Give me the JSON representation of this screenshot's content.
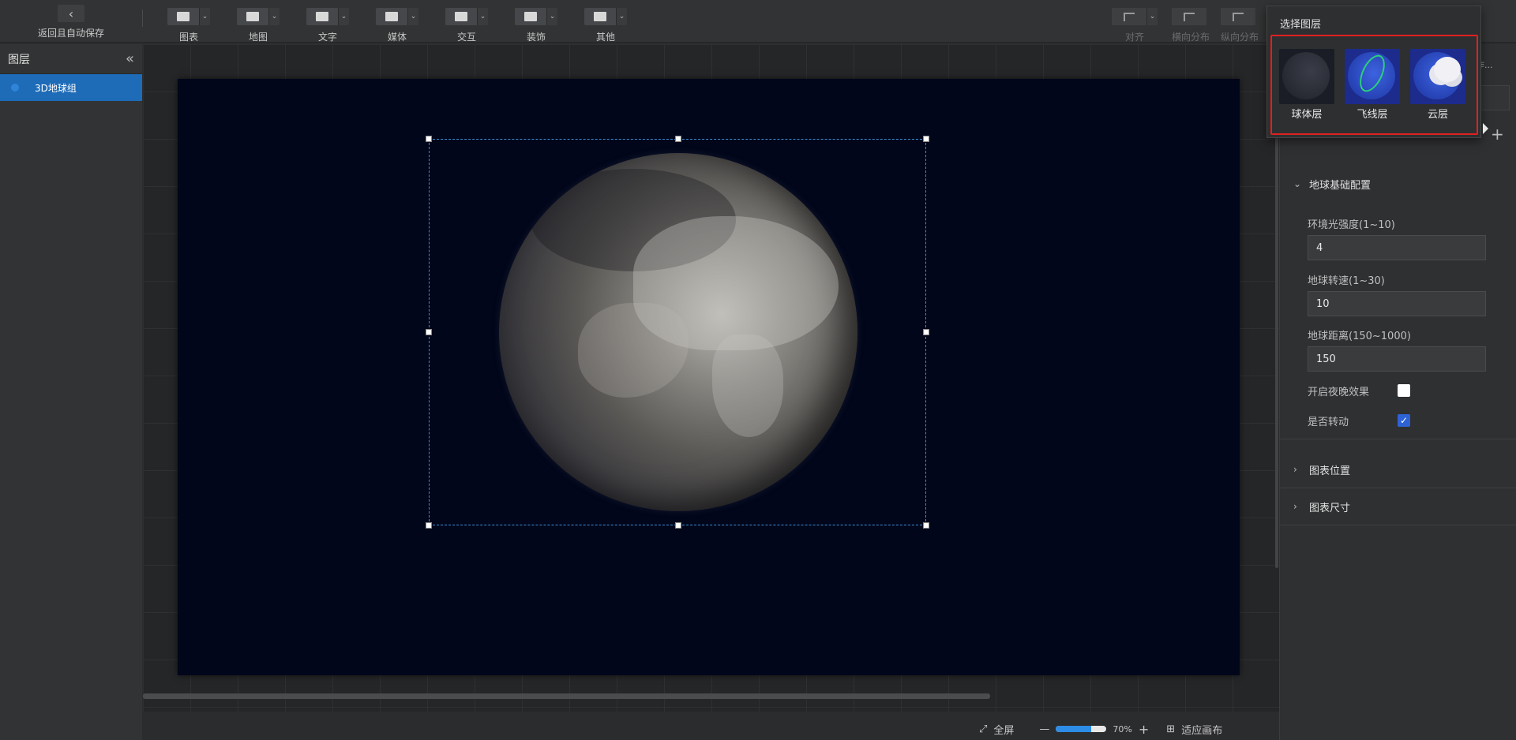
{
  "toolbar": {
    "back_label": "返回且自动保存",
    "items": [
      {
        "label": "图表",
        "icon": "chart-icon"
      },
      {
        "label": "地图",
        "icon": "map-icon"
      },
      {
        "label": "文字",
        "icon": "text-icon"
      },
      {
        "label": "媒体",
        "icon": "media-icon"
      },
      {
        "label": "交互",
        "icon": "interaction-icon"
      },
      {
        "label": "装饰",
        "icon": "decoration-icon"
      },
      {
        "label": "其他",
        "icon": "other-icon"
      }
    ],
    "align_label": "对齐",
    "hdist_label": "横向分布",
    "vdist_label": "纵向分布"
  },
  "layers": {
    "title": "图层",
    "items": [
      {
        "label": "3D地球组",
        "selected": true
      }
    ]
  },
  "popup": {
    "title": "选择图层",
    "items": [
      {
        "label": "球体层"
      },
      {
        "label": "飞线层"
      },
      {
        "label": "云层"
      }
    ]
  },
  "right_panel": {
    "partial_tab": "操作...",
    "sections": {
      "base": "地球基础配置",
      "position": "图表位置",
      "size": "图表尺寸"
    },
    "fields": {
      "ambient_label": "环境光强度(1~10)",
      "ambient_value": "4",
      "speed_label": "地球转速(1~30)",
      "speed_value": "10",
      "distance_label": "地球距离(150~1000)",
      "distance_value": "150",
      "night_label": "开启夜晚效果",
      "night_checked": false,
      "rotate_label": "是否转动",
      "rotate_checked": true
    }
  },
  "status": {
    "fullscreen_label": "全屏",
    "zoom_percent": "70%",
    "zoom_fraction": 0.7,
    "fit_label": "适应画布"
  },
  "colors": {
    "accent": "#1e6bb8",
    "stage_bg": "#01061a",
    "highlight_red": "#e02020"
  }
}
